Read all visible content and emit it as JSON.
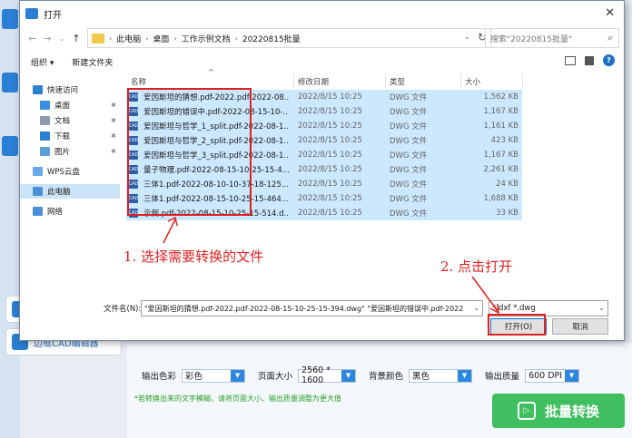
{
  "dialog": {
    "title": "打开",
    "close": "✕",
    "nav": {
      "back": "←",
      "forward": "→",
      "recent": "⌄",
      "up": "↑"
    },
    "breadcrumbs": [
      "此电脑",
      "桌面",
      "工作示例文档",
      "20220815批量"
    ],
    "address_dropdown": "⌄",
    "refresh": "↻",
    "search_placeholder": "搜索\"20220815批量\"",
    "toolbar": {
      "organize": "组织 ▾",
      "new_folder": "新建文件夹",
      "help": "?"
    },
    "navpane": [
      {
        "label": "快速访问",
        "icon": "star-icon",
        "color": "#2b7fd4"
      },
      {
        "label": "桌面",
        "icon": "desktop-icon",
        "color": "#3b8ee0",
        "pinned": true
      },
      {
        "label": "文档",
        "icon": "document-icon",
        "color": "#8c9bb0",
        "pinned": true
      },
      {
        "label": "下载",
        "icon": "download-icon",
        "color": "#2b7fd4",
        "pinned": true
      },
      {
        "label": "图片",
        "icon": "pictures-icon",
        "color": "#5aa0d8",
        "pinned": true
      },
      {
        "label": "WPS云盘",
        "icon": "cloud-icon",
        "color": "#6aa9e9"
      },
      {
        "label": "此电脑",
        "icon": "computer-icon",
        "color": "#4a90d9",
        "selected": true
      },
      {
        "label": "网络",
        "icon": "network-icon",
        "color": "#4a90d9"
      }
    ],
    "columns": {
      "name": "名称",
      "date": "修改日期",
      "type": "类型",
      "size": "大小",
      "sort": "^"
    },
    "files": [
      {
        "name": "爱因斯坦的猜想.pdf-2022.pdf-2022-08...",
        "date": "2022/8/15 10:25",
        "type": "DWG 文件",
        "size": "1,562 KB"
      },
      {
        "name": "爱因斯坦的错误中.pdf-2022-08-15-10-...",
        "date": "2022/8/15 10:25",
        "type": "DWG 文件",
        "size": "1,167 KB"
      },
      {
        "name": "爱因斯坦与哲学_1_split.pdf-2022-08-1...",
        "date": "2022/8/15 10:25",
        "type": "DWG 文件",
        "size": "1,161 KB"
      },
      {
        "name": "爱因斯坦与哲学_2_split.pdf-2022-08-1...",
        "date": "2022/8/15 10:25",
        "type": "DWG 文件",
        "size": "423 KB"
      },
      {
        "name": "爱因斯坦与哲学_3_split.pdf-2022-08-1...",
        "date": "2022/8/15 10:25",
        "type": "DWG 文件",
        "size": "1,167 KB"
      },
      {
        "name": "量子物理.pdf-2022-08-15-10-25-15-4...",
        "date": "2022/8/15 10:25",
        "type": "DWG 文件",
        "size": "2,261 KB"
      },
      {
        "name": "三体1.pdf-2022-08-10-10-37-18-125....",
        "date": "2022/8/15 10:25",
        "type": "DWG 文件",
        "size": "24 KB"
      },
      {
        "name": "三体1.pdf-2022-08-15-10-25-15-464....",
        "date": "2022/8/15 10:25",
        "type": "DWG 文件",
        "size": "1,688 KB"
      },
      {
        "name": "示例.pdf-2022-08-15-10-25-15-514.d...",
        "date": "2022/8/15 10:25",
        "type": "DWG 文件",
        "size": "33 KB"
      }
    ],
    "file_icon_text": "CAD",
    "filename_label": "文件名(N):",
    "filename_value": "\"爱因斯坦的猜想.pdf-2022.pdf-2022-08-15-10-25-15-394.dwg\" \"爱因斯坦的错误中.pdf-2022",
    "filter_value": "*.dxf *.dwg",
    "dropdown": "⌄",
    "open_button": "打开(O)",
    "cancel_button": "取消"
  },
  "annotations": {
    "step1": "1. 选择需要转换的文件",
    "step2": "2. 点击打开"
  },
  "app": {
    "sidebar_tool_label": "边框CAD编辑器",
    "options": [
      {
        "label": "输出色彩",
        "value": "彩色"
      },
      {
        "label": "页面大小",
        "value": "2560 * 1600"
      },
      {
        "label": "背景颜色",
        "value": "黑色"
      },
      {
        "label": "输出质量",
        "value": "600 DPI"
      }
    ],
    "hint": "*若转换出来的文字模糊，请将页面大小、输出质量调整为更大值",
    "convert_button": "批量转换",
    "convert_icon": "▷",
    "select_arrow": "▼"
  }
}
